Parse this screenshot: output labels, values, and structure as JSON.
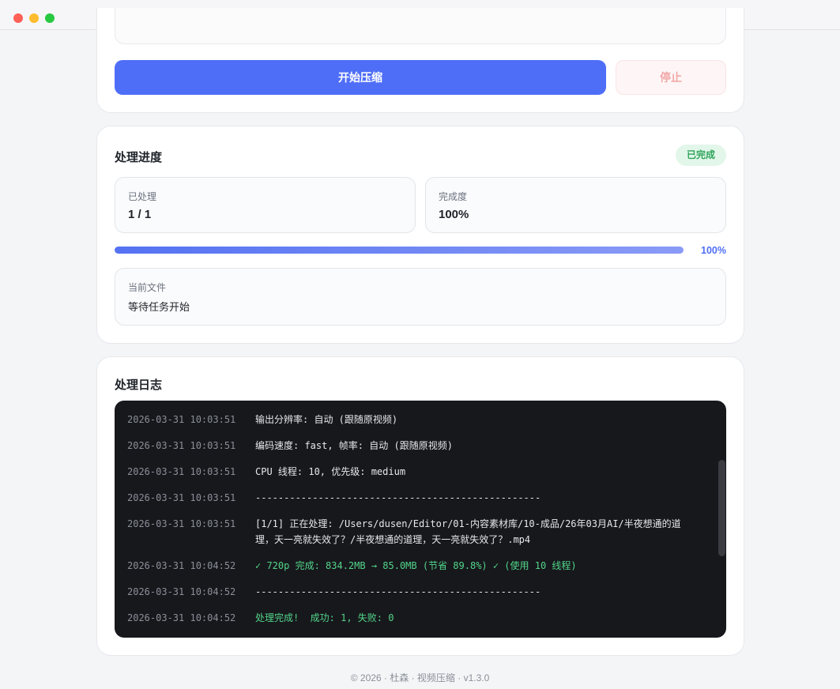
{
  "window": {
    "controls": [
      "close",
      "minimize",
      "maximize"
    ]
  },
  "actions": {
    "start_label": "开始压缩",
    "stop_label": "停止"
  },
  "progress": {
    "title": "处理进度",
    "status": "已完成",
    "processed_label": "已处理",
    "processed_value": "1 / 1",
    "completion_label": "完成度",
    "completion_value": "100%",
    "bar_percent": 100,
    "bar_text": "100%",
    "current_file_label": "当前文件",
    "current_file_value": "等待任务开始"
  },
  "log": {
    "title": "处理日志",
    "entries": [
      {
        "time": "2026-03-31 10:03:51",
        "message": "输出分辨率: 自动 (跟随原视频)",
        "type": "info"
      },
      {
        "time": "2026-03-31 10:03:51",
        "message": "编码速度: fast, 帧率: 自动 (跟随原视频)",
        "type": "info"
      },
      {
        "time": "2026-03-31 10:03:51",
        "message": "CPU 线程: 10, 优先级: medium",
        "type": "info"
      },
      {
        "time": "2026-03-31 10:03:51",
        "message": "--------------------------------------------------",
        "type": "info"
      },
      {
        "time": "2026-03-31 10:03:51",
        "message": "[1/1] 正在处理: /Users/dusen/Editor/01-内容素材库/10-成品/26年03月AI/半夜想通的道理，天一亮就失效了？/半夜想通的道理，天一亮就失效了？.mp4",
        "type": "info"
      },
      {
        "time": "2026-03-31 10:04:52",
        "message": "✓ 720p 完成: 834.2MB → 85.0MB (节省 89.8%) ✓ (使用 10 线程)",
        "type": "success"
      },
      {
        "time": "2026-03-31 10:04:52",
        "message": "--------------------------------------------------",
        "type": "info"
      },
      {
        "time": "2026-03-31 10:04:52",
        "message": "处理完成!  成功: 1, 失败: 0",
        "type": "success"
      }
    ]
  },
  "footer": {
    "text": "© 2026 · 杜森 · 视频压缩 · v1.3.0"
  }
}
